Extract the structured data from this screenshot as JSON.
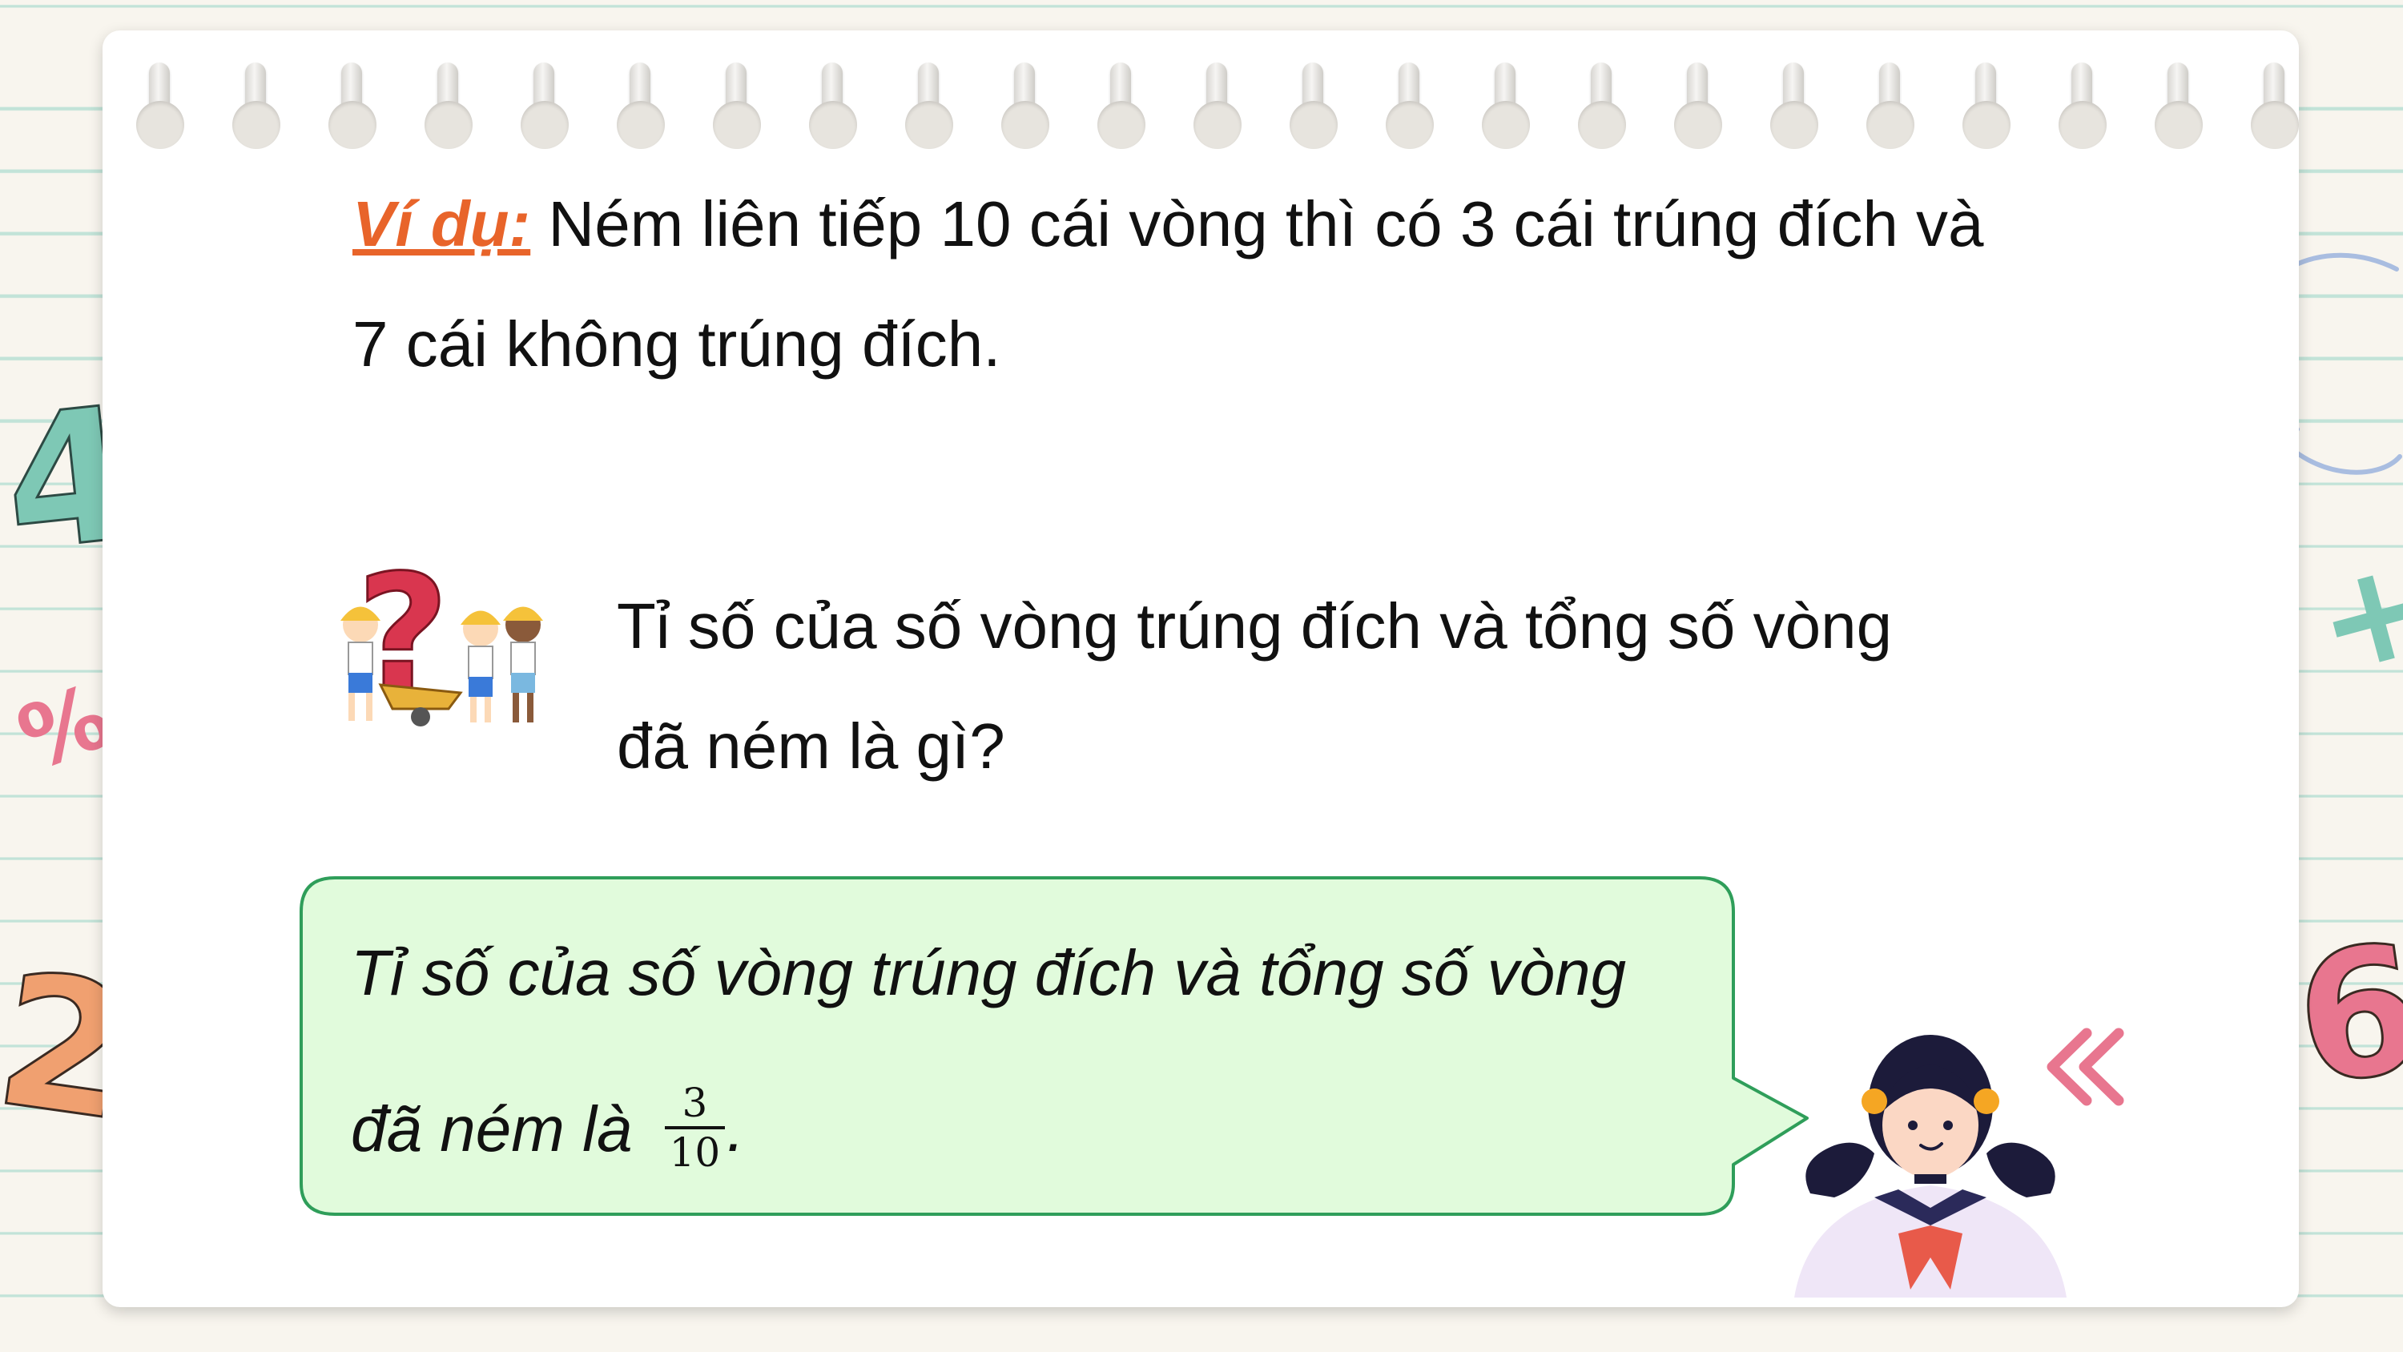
{
  "example": {
    "label": "Ví dụ:",
    "line1": " Ném liên tiếp 10 cái vòng thì có 3 cái trúng đích và",
    "line2": "7 cái không trúng đích."
  },
  "question": {
    "line1": "Tỉ số của số vòng trúng đích và tổng số vòng",
    "line2": "đã ném là gì?"
  },
  "answer": {
    "line1": "Tỉ số của số vòng trúng đích và tổng số vòng",
    "line2_prefix": "đã ném là ",
    "fraction_numerator": "3",
    "fraction_denominator": "10",
    "line2_suffix": "."
  },
  "decorations": {
    "digit_four": "4",
    "digit_two": "2",
    "digit_six": "6",
    "percent_sign": "%",
    "plus_sign": "+",
    "question_mark": "?"
  },
  "colors": {
    "background": "#f8f5ee",
    "page_lines": "#c2e3d8",
    "label_orange": "#e8642a",
    "bubble_fill": "#e1fbdc",
    "bubble_border": "#2f9e5a",
    "teal": "#7ec8b5",
    "pink": "#e8768f",
    "orange": "#f0a070",
    "blue_arrow": "#a9bde0"
  }
}
